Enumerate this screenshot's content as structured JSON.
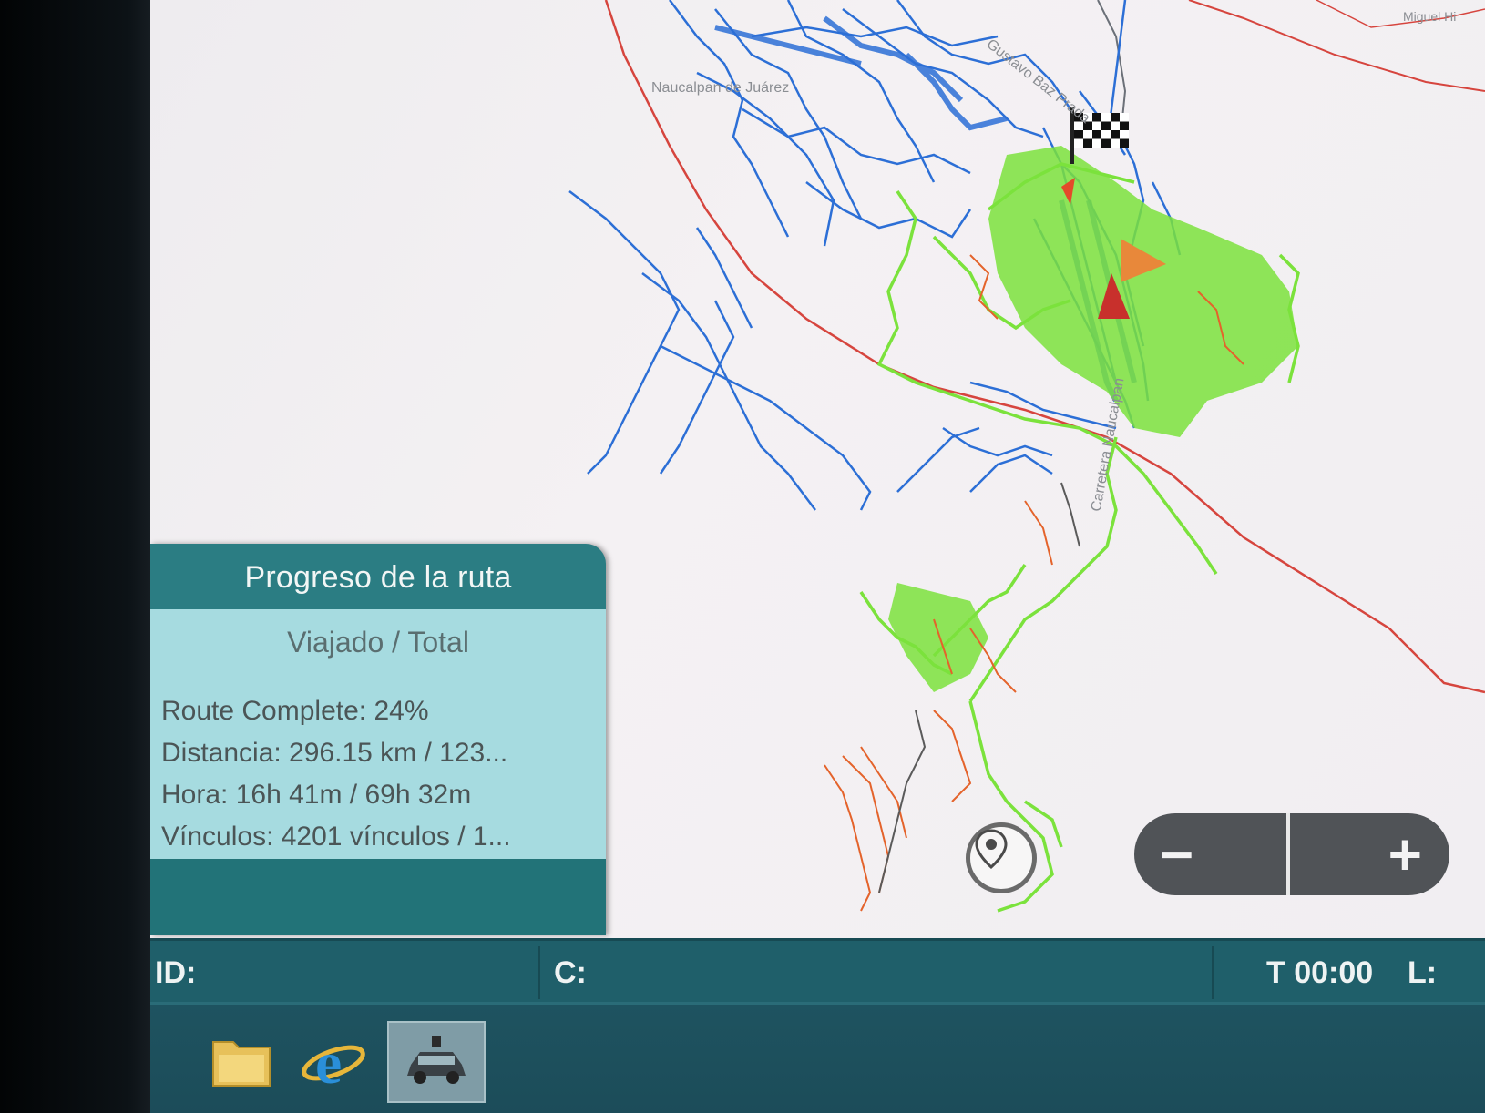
{
  "map": {
    "labels": {
      "city": "Naucalpan de Juárez",
      "road_top": "Gustavo Baz Prada",
      "road_vertical": "Carretera Naucalpan",
      "corner": "Miguel Hi"
    },
    "icons": {
      "finish": "checkered-flag-icon",
      "vehicle": "vehicle-arrow-icon",
      "locate": "locate-pin-icon"
    },
    "colors": {
      "road_blue": "#2c6fd6",
      "route_green": "#7be23c",
      "trail_orange": "#e4632b",
      "highway_red": "#d6453e"
    }
  },
  "route_panel": {
    "title": "Progreso de la ruta",
    "subtitle": "Viajado / Total",
    "complete": "Route Complete: 24%",
    "distance": "Distancia: 296.15 km / 123...",
    "time": "Hora: 16h 41m / 69h 32m",
    "links": "Vínculos: 4201 vínculos / 1..."
  },
  "zoom": {
    "minus": "−",
    "plus": "+"
  },
  "status_bar": {
    "id_label": "ID:",
    "c_label": "C:",
    "time": "T 00:00",
    "l_label": "L:"
  },
  "taskbar": {
    "items": [
      "folder-icon",
      "internet-explorer-icon",
      "vehicle-app-icon"
    ]
  }
}
